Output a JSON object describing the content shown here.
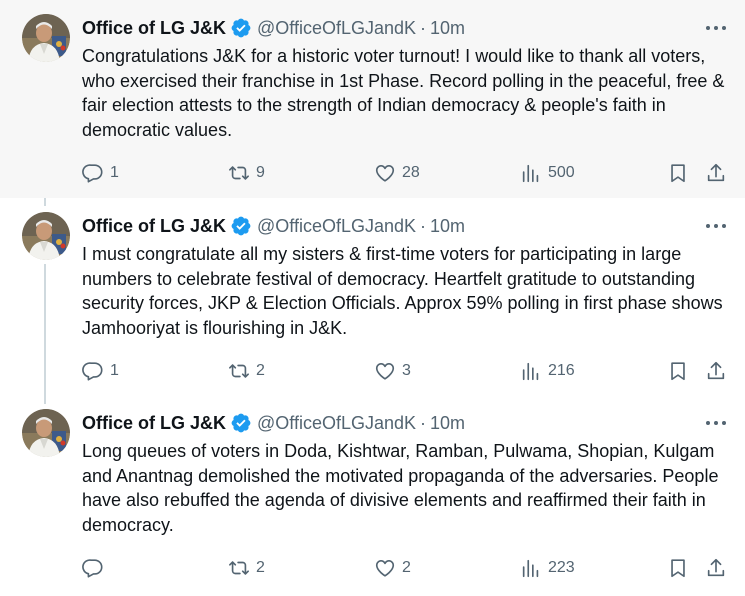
{
  "colors": {
    "text": "#0f1419",
    "secondary": "#536471",
    "verified": "#1d9bf0",
    "highlight_bg": "#f7f7f7",
    "thread_line": "#cfd9de"
  },
  "tweets": [
    {
      "author_name": "Office of LG J&K",
      "handle": "@OfficeOfLGJandK",
      "separator": "·",
      "time": "10m",
      "text": "Congratulations J&K for a historic voter turnout! I would like to thank all voters, who exercised their franchise in 1st Phase. Record polling in the peaceful, free & fair election attests to the strength of Indian democracy & people's faith in democratic values.",
      "replies": "1",
      "reposts": "9",
      "likes": "28",
      "views": "500"
    },
    {
      "author_name": "Office of LG J&K",
      "handle": "@OfficeOfLGJandK",
      "separator": "·",
      "time": "10m",
      "text": "I must congratulate all my sisters & first-time voters for participating in large numbers to celebrate festival of democracy. Heartfelt gratitude to outstanding security forces, JKP & Election Officials. Approx 59% polling in first phase shows Jamhooriyat is flourishing in J&K.",
      "replies": "1",
      "reposts": "2",
      "likes": "3",
      "views": "216"
    },
    {
      "author_name": "Office of LG J&K",
      "handle": "@OfficeOfLGJandK",
      "separator": "·",
      "time": "10m",
      "text": "Long queues of voters in Doda, Kishtwar, Ramban, Pulwama, Shopian, Kulgam and Anantnag demolished the motivated propaganda of the adversaries. People have also rebuffed the agenda  of divisive elements and reaffirmed their faith in democracy.",
      "replies": "",
      "reposts": "2",
      "likes": "2",
      "views": "223"
    }
  ]
}
